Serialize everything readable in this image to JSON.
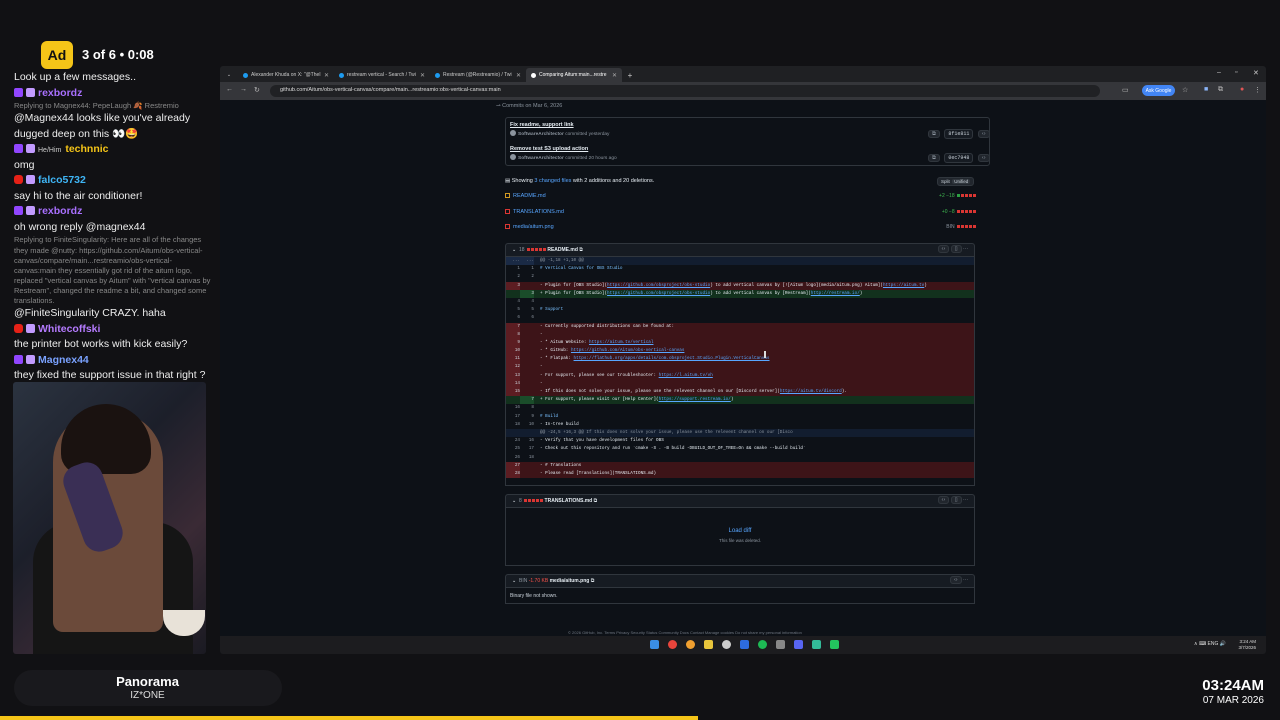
{
  "ad": {
    "badge": "Ad",
    "text": "3 of 6 • 0:08"
  },
  "chat": [
    {
      "type": "text",
      "text": "Look up a few messages.."
    },
    {
      "type": "user",
      "platform": "twitch",
      "name": "rexbordz",
      "color": "#a970ff"
    },
    {
      "type": "reply",
      "text": "Replying to Magnex44: PepeLaugh 🍂 Restremio"
    },
    {
      "type": "text",
      "text": "@Magnex44 looks like you've already dugged deep on this 👀🤩"
    },
    {
      "type": "user",
      "platform": "twitch",
      "name": "technnic",
      "color": "#f5c518",
      "tag": "He/Him"
    },
    {
      "type": "text",
      "text": "omg"
    },
    {
      "type": "user",
      "platform": "youtube",
      "name": "falco5732",
      "color": "#3fb5f5"
    },
    {
      "type": "text",
      "text": "say hi to the air conditioner!"
    },
    {
      "type": "user",
      "platform": "twitch",
      "name": "rexbordz",
      "color": "#a970ff"
    },
    {
      "type": "text",
      "text": "oh wrong reply @magnex44"
    },
    {
      "type": "reply",
      "text": "Replying to FiniteSingularity: Here are all of the changes they made @nutty: https://github.com/Aitum/obs-vertical-canvas/compare/main...restreamio/obs-vertical-canvas:main they essentially got rid of the aitum logo, replaced \"vertical canvas by Aitum\" with \"vertical canvas by Restream\", changed the readme a bit, and changed some translations."
    },
    {
      "type": "text",
      "text": "@FiniteSingularity CRAZY. haha"
    },
    {
      "type": "user",
      "platform": "youtube",
      "name": "Whitecoffski",
      "color": "#b57bff"
    },
    {
      "type": "text",
      "text": "the printer bot works with kick easily?"
    },
    {
      "type": "user",
      "platform": "twitch",
      "name": "Magnex44",
      "color": "#7aa2ff"
    },
    {
      "type": "text",
      "text": "they fixed the support issue in that right ?"
    }
  ],
  "music": {
    "title": "Panorama",
    "artist": "IZ*ONE"
  },
  "overlay_clock": {
    "time": "03:24AM",
    "date": "07 MAR 2026"
  },
  "ad_progress": 0.545,
  "browser": {
    "tabs": [
      {
        "label": "Alexander Khuda on X: \"@TheI",
        "active": false
      },
      {
        "label": "restream vertical - Search / Twi",
        "active": false
      },
      {
        "label": "Restream (@Restreamio) / Twi",
        "active": false
      },
      {
        "label": "Comparing Aitum:main...restre",
        "active": true
      }
    ],
    "url": "github.com/Aitum/obs-vertical-canvas/compare/main...restreamio:obs-vertical-canvas:main",
    "ask_google": "Ask Google"
  },
  "github": {
    "commits_header": "Commits on Mar 6, 2026",
    "commits": [
      {
        "title": "Fix readme, support link",
        "author": "SoftwareArchitector",
        "when": "committed yesterday",
        "sha": "8f1e811"
      },
      {
        "title": "Remove test S3 upload action",
        "author": "SoftwareArchitector",
        "when": "committed 20 hours ago",
        "sha": "0ec7948"
      }
    ],
    "summary_prefix": "Showing",
    "summary_link": "3 changed files",
    "summary_rest": "with 2 additions and 20 deletions.",
    "split": "Split",
    "unified": "Unified",
    "files": [
      {
        "name": "README.md",
        "stat": "+2 −18",
        "add": 1,
        "del": 4
      },
      {
        "name": "TRANSLATIONS.md",
        "stat": "+0 −8",
        "add": 0,
        "del": 5
      },
      {
        "name": "media/aitum.png",
        "stat": "BIN",
        "add": 0,
        "del": 5
      }
    ],
    "readme_header": {
      "count": "18",
      "name": "README.md"
    },
    "diff_lines": [
      {
        "kind": "hunk",
        "n1": "...",
        "n2": "...",
        "text": "@@ -1,18 +1,10 @@"
      },
      {
        "kind": "ctx",
        "n1": "1",
        "n2": "1",
        "text": "# Vertical Canvas for OBS Studio",
        "style": "hd"
      },
      {
        "kind": "ctx",
        "n1": "2",
        "n2": "2",
        "text": ""
      },
      {
        "kind": "del",
        "n1": "3",
        "n2": "",
        "text": "- Plugin for [OBS Studio](https://github.com/obsproject/obs-studio) to add vertical canvas by [![Aitum logo](media/aitum.png) Aitum](https://aitum.tv)"
      },
      {
        "kind": "add",
        "n1": "",
        "n2": "3",
        "text": "+ Plugin for [OBS Studio](https://github.com/obsproject/obs-studio) to add vertical canvas by [Restream](http://restream.io/)"
      },
      {
        "kind": "ctx",
        "n1": "4",
        "n2": "4",
        "text": ""
      },
      {
        "kind": "ctx",
        "n1": "5",
        "n2": "5",
        "text": "# Support",
        "style": "hd"
      },
      {
        "kind": "ctx",
        "n1": "6",
        "n2": "6",
        "text": ""
      },
      {
        "kind": "del",
        "n1": "7",
        "n2": "",
        "text": "- Currently supported distributions can be found at:"
      },
      {
        "kind": "del",
        "n1": "8",
        "n2": "",
        "text": "-"
      },
      {
        "kind": "del",
        "n1": "9",
        "n2": "",
        "text": "- * Aitum Website: https://aitum.tv/vertical"
      },
      {
        "kind": "del",
        "n1": "10",
        "n2": "",
        "text": "- * GitHub: https://github.com/Aitum/obs-vertical-canvas"
      },
      {
        "kind": "del",
        "n1": "11",
        "n2": "",
        "text": "- * Flatpak: https://flathub.org/apps/details/com.obsproject.Studio.Plugin.VerticalCanvas"
      },
      {
        "kind": "del",
        "n1": "12",
        "n2": "",
        "text": "-"
      },
      {
        "kind": "del",
        "n1": "13",
        "n2": "",
        "text": "- For support, please see our troubleshooter: https://l.aitum.tv/vh"
      },
      {
        "kind": "del",
        "n1": "14",
        "n2": "",
        "text": "-"
      },
      {
        "kind": "del",
        "n1": "15",
        "n2": "",
        "text": "- If this does not solve your issue, please use the relevent channel on our [Discord server](https://aitum.tv/discord)."
      },
      {
        "kind": "add",
        "n1": "",
        "n2": "7",
        "text": "+ For support, please visit our [Help Center](https://support.restream.io/)"
      },
      {
        "kind": "ctx",
        "n1": "16",
        "n2": "8",
        "text": ""
      },
      {
        "kind": "ctx",
        "n1": "17",
        "n2": "9",
        "text": "# Build",
        "style": "hd"
      },
      {
        "kind": "ctx",
        "n1": "18",
        "n2": "10",
        "text": "- In-tree build"
      },
      {
        "kind": "hunk",
        "n1": "",
        "n2": "",
        "text": "@@ -24,5 +16,3 @@ If this does not solve your issue, please use the relevent channel on our [Disco"
      },
      {
        "kind": "ctx",
        "n1": "24",
        "n2": "16",
        "text": "    - Verify that you have development files for OBS"
      },
      {
        "kind": "ctx",
        "n1": "25",
        "n2": "17",
        "text": "    - Check out this repository and run `cmake -S . -B build -DBUILD_OUT_OF_TREE=On && cmake --build build`"
      },
      {
        "kind": "ctx",
        "n1": "26",
        "n2": "18",
        "text": ""
      },
      {
        "kind": "del",
        "n1": "27",
        "n2": "",
        "text": "- # Translations"
      },
      {
        "kind": "del",
        "n1": "28",
        "n2": "",
        "text": "- Please read [Translations](TRANSLATIONS.md)"
      }
    ],
    "translations_header": {
      "count": "8",
      "name": "TRANSLATIONS.md"
    },
    "load_diff": "Load diff",
    "deleted_note": "This file was deleted.",
    "bin_header": {
      "label": "BIN",
      "stat": "-1.70 KB",
      "name": "media/aitum.png"
    },
    "binary_note": "Binary file not shown.",
    "footer": "© 2026 GitHub, Inc.   Terms   Privacy   Security   Status   Community   Docs   Contact   Manage cookies   Do not share my personal information"
  },
  "system": {
    "time": "3:24 AM",
    "date": "3/7/2026",
    "tray": "∧  ⌨  ENG  🔊"
  },
  "colors": {
    "github_bg": "#0d1117",
    "deleted": "#3d1418",
    "added": "#12311d",
    "link": "#58a6ff",
    "ad_yellow": "#f5c518"
  }
}
